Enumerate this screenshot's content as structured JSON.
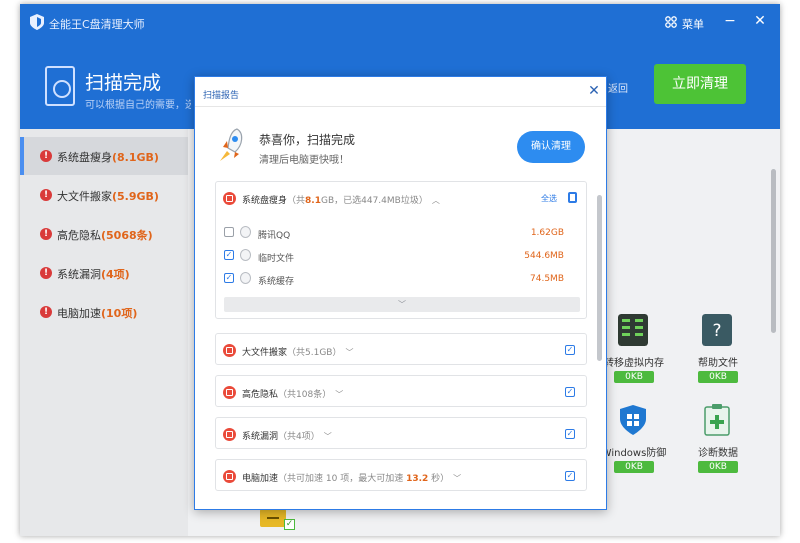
{
  "app": {
    "title": "全能王C盘清理大师",
    "menu_label": "菜单",
    "min_icon": "−",
    "close_icon": "✕"
  },
  "header": {
    "title": "扫描完成",
    "subtitle": "可以根据自己的需要，选择",
    "back_label": "返回",
    "clean_button": "立即清理"
  },
  "sidebar": {
    "items": [
      {
        "label": "系统盘瘦身",
        "count": "(8.1GB)"
      },
      {
        "label": "大文件搬家",
        "count": "(5.9GB)"
      },
      {
        "label": "高危隐私",
        "count": "(5068条)"
      },
      {
        "label": "系统漏洞",
        "count": "(4项)"
      },
      {
        "label": "电脑加速",
        "count": "(10项)"
      }
    ]
  },
  "background_tiles": [
    {
      "label": "转移虚拟内存",
      "size": "0KB",
      "icon": "memory-icon"
    },
    {
      "label": "帮助文件",
      "size": "0KB",
      "icon": "help-icon"
    },
    {
      "label": "Windows防御",
      "size": "0KB",
      "icon": "shield-icon"
    },
    {
      "label": "诊断数据",
      "size": "0KB",
      "icon": "clipboard-icon"
    }
  ],
  "dialog": {
    "title": "扫描报告",
    "close": "✕",
    "congrats": "恭喜你，扫描完成",
    "congrats_sub": "清理后电脑更快哦！",
    "confirm_button": "确认清理",
    "select_all": "全选",
    "sections": [
      {
        "title": "系统盘瘦身",
        "detail_pre": "（共",
        "detail_hl": "8.1",
        "detail_post": "GB，已选447.4MB垃圾）",
        "expanded": true,
        "items": [
          {
            "label": "腾讯QQ",
            "size": "1.62GB",
            "checked": false
          },
          {
            "label": "临时文件",
            "size": "544.6MB",
            "checked": true
          },
          {
            "label": "系统缓存",
            "size": "74.5MB",
            "checked": true
          }
        ]
      },
      {
        "title": "大文件搬家",
        "detail_pre": "（共5.1GB）",
        "detail_hl": "",
        "detail_post": "",
        "expanded": false
      },
      {
        "title": "高危隐私",
        "detail_pre": "（共108条）",
        "detail_hl": "",
        "detail_post": "",
        "expanded": false
      },
      {
        "title": "系统漏洞",
        "detail_pre": "（共4项）",
        "detail_hl": "",
        "detail_post": "",
        "expanded": false
      },
      {
        "title": "电脑加速",
        "detail_pre": "（共可加速 10 项，最大可加速 ",
        "detail_hl": "13.2",
        "detail_post": " 秒）",
        "expanded": false
      }
    ]
  },
  "colors": {
    "brand_blue": "#1f6fd4",
    "accent_blue": "#2d8cf0",
    "green": "#4dc336",
    "alert_red": "#d93a3a",
    "orange": "#e0651b"
  }
}
